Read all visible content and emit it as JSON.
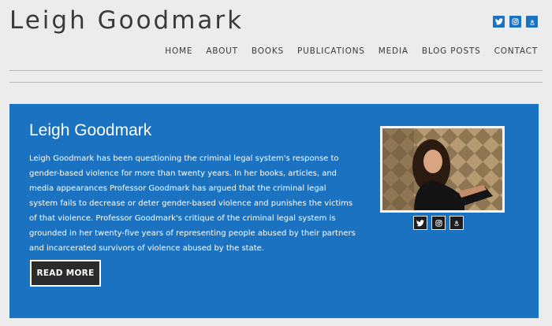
{
  "site": {
    "title": "Leigh Goodmark"
  },
  "nav": {
    "items": [
      {
        "label": "HOME"
      },
      {
        "label": "ABOUT"
      },
      {
        "label": "BOOKS"
      },
      {
        "label": "PUBLICATIONS"
      },
      {
        "label": "MEDIA"
      },
      {
        "label": "BLOG POSTS"
      },
      {
        "label": "CONTACT"
      }
    ]
  },
  "social_icons": [
    "twitter-icon",
    "instagram-icon",
    "amazon-icon"
  ],
  "hero": {
    "heading": "Leigh Goodmark",
    "bio": "Leigh Goodmark has been questioning the criminal legal system's response to gender-based violence for more than twenty years.  In her books, articles, and media appearances Professor Goodmark has argued that the criminal legal system fails to decrease or deter gender-based violence and punishes the victims of that violence.  Professor Goodmark's critique of the criminal legal system is grounded in her twenty-five years of representing people abused by their partners and incarcerated survivors of violence abused by the state.",
    "button_label": "READ MORE"
  },
  "colors": {
    "hero_background": "#1a72c0",
    "social_icon_blue": "#1a73c2",
    "page_background": "#ececec"
  }
}
